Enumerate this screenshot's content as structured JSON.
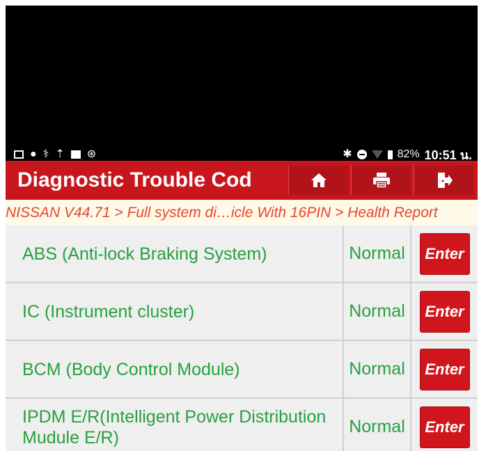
{
  "status_bar": {
    "left_icons": [
      "gmail-icon",
      "chat-icon",
      "usb-debug-icon",
      "upload-icon",
      "image-icon",
      "bluetooth-scan-icon"
    ],
    "battery": "82%",
    "time": "10:51 น."
  },
  "header": {
    "title": "Diagnostic Trouble Cod",
    "buttons": [
      "home-icon",
      "print-icon",
      "exit-icon"
    ]
  },
  "breadcrumb": "NISSAN V44.71 > Full system di…icle With 16PIN > Health Report",
  "systems": [
    {
      "name": "ABS (Anti-lock Braking System)",
      "status": "Normal",
      "action": "Enter"
    },
    {
      "name": "IC (Instrument cluster)",
      "status": "Normal",
      "action": "Enter"
    },
    {
      "name": "BCM (Body Control Module)",
      "status": "Normal",
      "action": "Enter"
    },
    {
      "name": "IPDM E/R(Intelligent Power Distribution Mudule E/R)",
      "status": "Normal",
      "action": "Enter"
    }
  ]
}
